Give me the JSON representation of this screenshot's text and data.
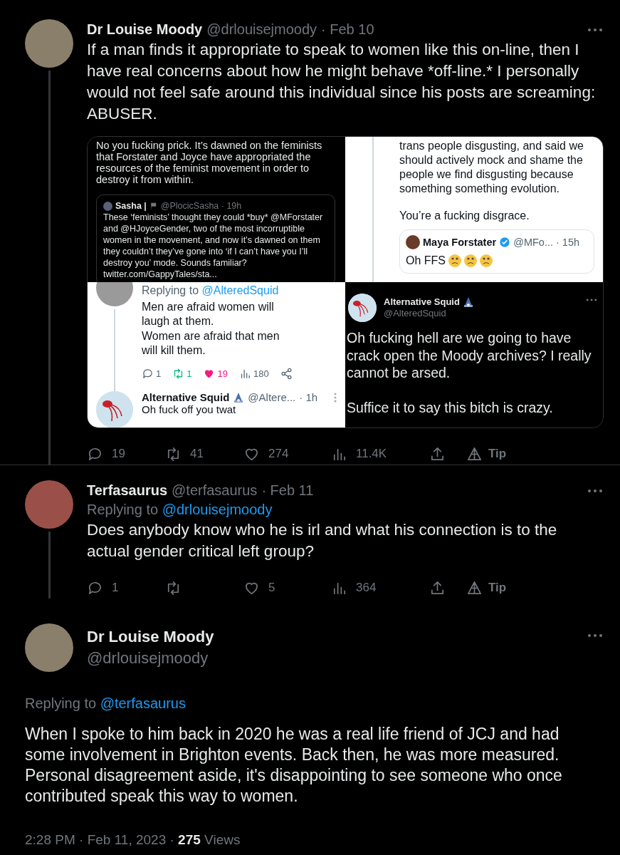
{
  "thread": [
    {
      "name": "Dr Louise Moody",
      "handle": "@drlouisejmoody",
      "date": "· Feb 10",
      "connected": true,
      "text": "If a man finds it appropriate to speak to women like this on-line, then I have real concerns about how he might behave *off-line.* I personally would not feel safe around this individual since his posts are screaming: ABUSER.",
      "media": [
        {
          "kind": "dark-quote",
          "text": "No you fucking prick. It’s dawned on the feminists that Forstater and Joyce have appropriated the resources of the feminist movement in order to destroy it from within.",
          "quote": {
            "name": "Sasha |",
            "handle": "@PlocicSasha · 19h",
            "text": "These ‘feminists’ thought they could *buy* @MForstater and @HJoyceGender, two of the most incorruptible women in the movement, and now it’s dawned on them they couldn’t they’ve gone into ‘if I can’t have you I’ll destroy you’ mode. Sounds familiar? twitter.com/GappyTales/sta..."
          }
        },
        {
          "kind": "light-quote",
          "paragraphs": [
            "trans people disgusting, and said we should actively mock and shame the people we find disgusting because something something evolution.",
            "You’re a fucking disgrace."
          ],
          "quote": {
            "name": "Maya Forstater",
            "handle": "@MFo...",
            "time": "· 15h",
            "text": "Oh FFS"
          }
        },
        {
          "kind": "light-thread",
          "replying": "Replying to",
          "replying_handle": "@AlteredSquid",
          "text": "Men are afraid women will laugh at them.\nWomen are afraid that men will kill them.",
          "stats": [
            {
              "kind": "reply",
              "count": "1",
              "active": false
            },
            {
              "kind": "retweet",
              "count": "1",
              "active": true
            },
            {
              "kind": "like",
              "count": "19",
              "active": true
            },
            {
              "kind": "views",
              "count": "180",
              "active": false
            },
            {
              "kind": "share",
              "active": false
            }
          ],
          "reply": {
            "name": "Alternative Squid",
            "handle": "@Altere...",
            "time": "· 1h",
            "text": "Oh fuck off you twat"
          }
        },
        {
          "kind": "dark-tweet",
          "name": "Alternative Squid",
          "handle": "@AlteredSquid",
          "paragraphs": [
            "Oh fucking hell are we going to have crack open the Moody archives? I really cannot be arsed.",
            "Suffice it to say this bitch is crazy."
          ]
        }
      ],
      "actions": [
        {
          "kind": "reply",
          "label": "19"
        },
        {
          "kind": "retweet",
          "label": "41"
        },
        {
          "kind": "like",
          "label": "274"
        },
        {
          "kind": "views",
          "label": "11.4K"
        },
        {
          "kind": "share"
        },
        {
          "kind": "tip",
          "label": "Tip"
        }
      ]
    },
    {
      "name": "Terfasaurus",
      "handle": "@terfasaurus",
      "date": "· Feb 11",
      "connected": true,
      "replying": "Replying to",
      "replying_handle": "@drlouisejmoody",
      "text": "Does anybody know who he is irl and what his connection is to the actual gender critical left group?",
      "actions": [
        {
          "kind": "reply",
          "label": "1"
        },
        {
          "kind": "retweet"
        },
        {
          "kind": "like",
          "label": "5"
        },
        {
          "kind": "views",
          "label": "364"
        },
        {
          "kind": "share"
        },
        {
          "kind": "tip",
          "label": "Tip"
        }
      ]
    }
  ],
  "main_tweet": {
    "name": "Dr Louise Moody",
    "handle": "@drlouisejmoody",
    "replying": "Replying to",
    "replying_handle": "@terfasaurus",
    "text": "When I spoke to him back in 2020 he was a real life friend of JCJ and had some involvement in Brighton events. Back then, he was more measured. Personal disagreement aside, it's disappointing to see someone who once contributed speak this way to women.",
    "meta": "2:28 PM · Feb 11, 2023 · **275** Views"
  }
}
